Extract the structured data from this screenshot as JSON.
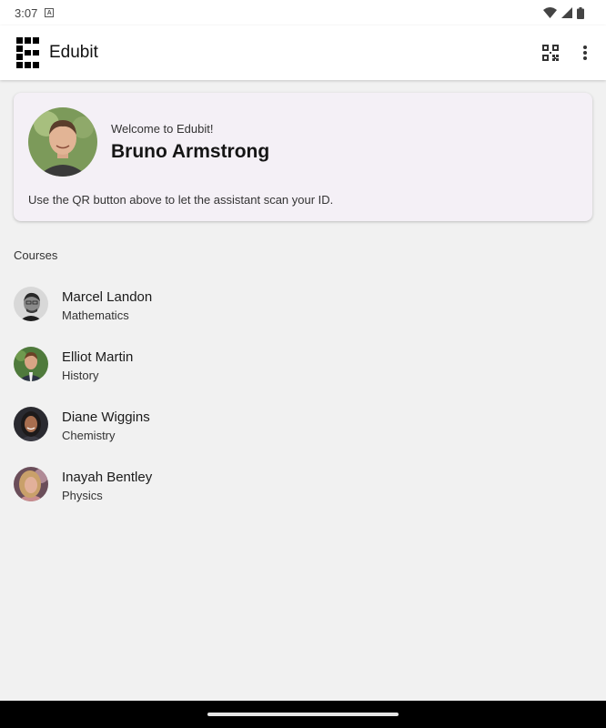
{
  "status_bar": {
    "time": "3:07",
    "notification_icon": "a-badge-icon",
    "icons": [
      "wifi-icon",
      "signal-icon",
      "battery-icon"
    ]
  },
  "app_bar": {
    "title": "Edubit",
    "logo_icon": "edubit-logo-icon",
    "actions": [
      "qr-code-icon",
      "more-vert-icon"
    ]
  },
  "welcome_card": {
    "greeting": "Welcome to Edubit!",
    "name": "Bruno Armstrong",
    "hint": "Use the QR button above to let the assistant scan your ID.",
    "background": "#f4f0f6"
  },
  "courses": {
    "label": "Courses",
    "items": [
      {
        "teacher": "Marcel Landon",
        "subject": "Mathematics"
      },
      {
        "teacher": "Elliot Martin",
        "subject": "History"
      },
      {
        "teacher": "Diane Wiggins",
        "subject": "Chemistry"
      },
      {
        "teacher": "Inayah Bentley",
        "subject": "Physics"
      }
    ]
  },
  "colors": {
    "background": "#f1f1f1",
    "app_bar": "#ffffff",
    "nav_bar": "#000000"
  }
}
